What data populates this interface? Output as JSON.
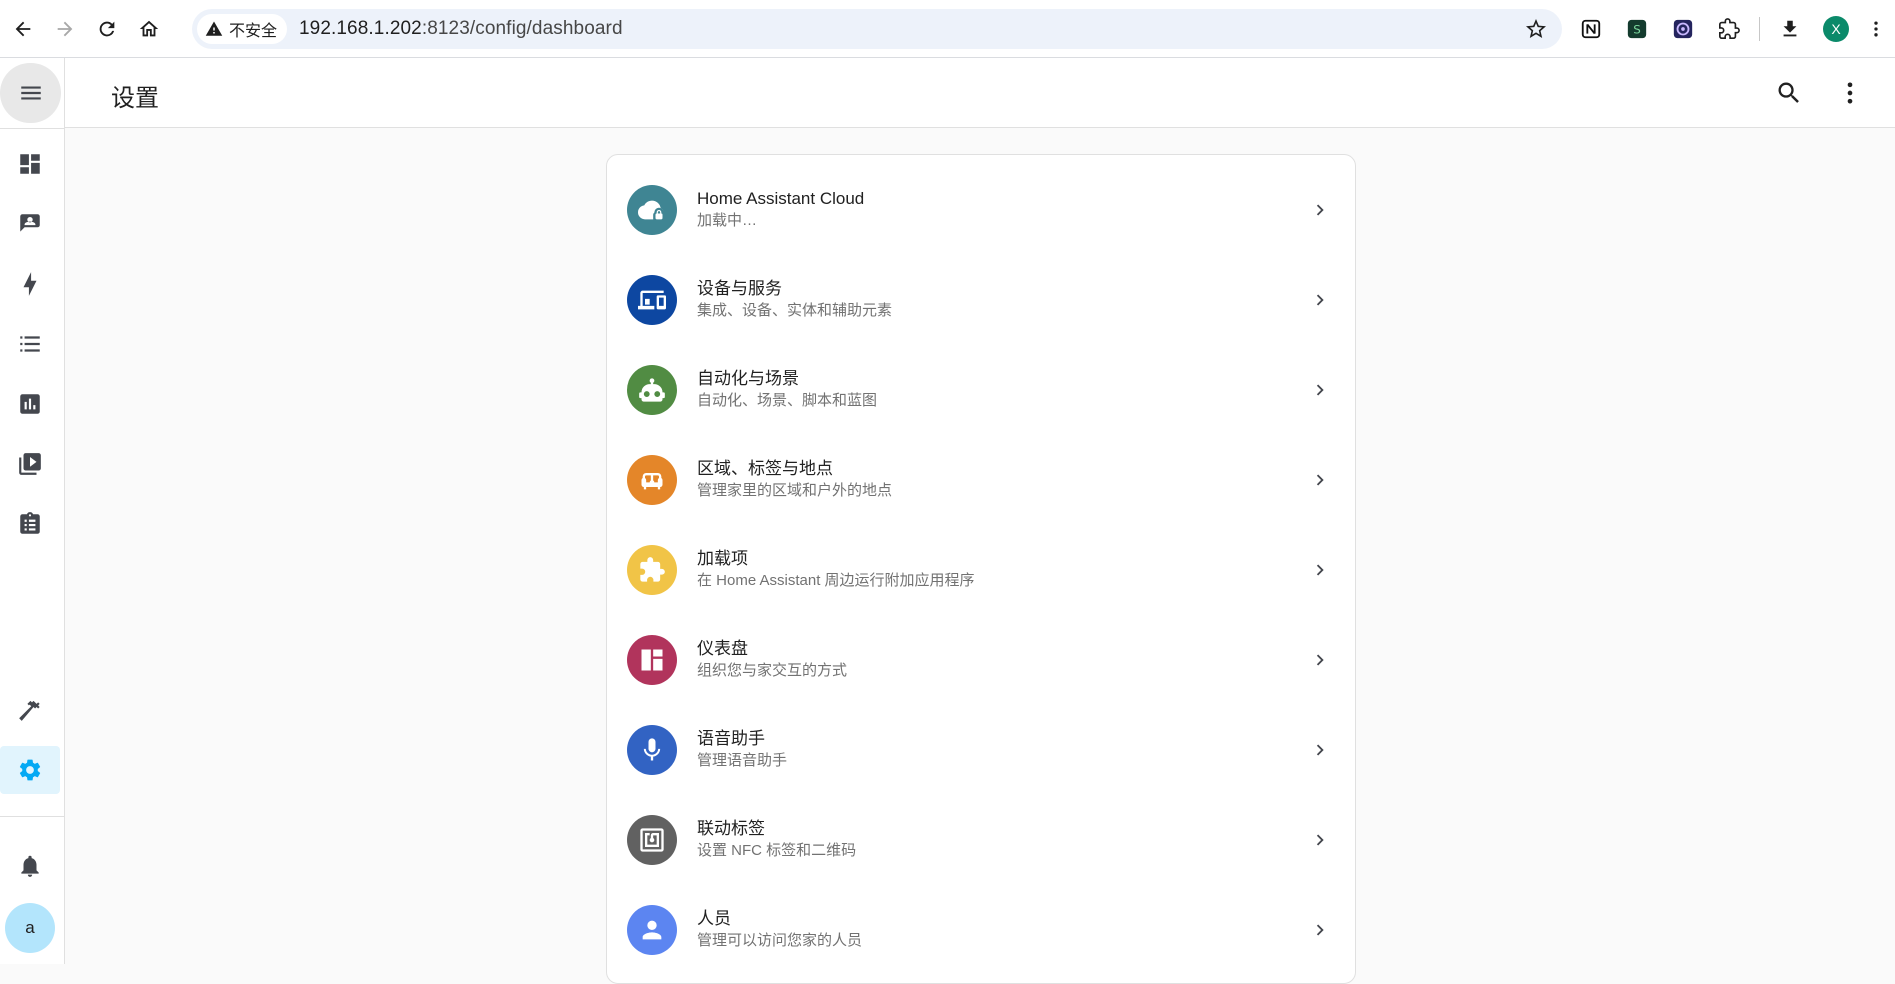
{
  "browser": {
    "insecure_label": "不安全",
    "url_host": "192.168.1.202",
    "url_path": ":8123/config/dashboard",
    "profile_initial": "X",
    "extensions": [
      "notion-icon",
      "docs-extension-icon",
      "vpn-extension-icon",
      "puzzle-icon"
    ]
  },
  "sidebar": {
    "items": [
      {
        "name": "overview",
        "icon": "dashboard-icon"
      },
      {
        "name": "map",
        "icon": "person-card-icon"
      },
      {
        "name": "energy",
        "icon": "lightning-icon"
      },
      {
        "name": "logbook",
        "icon": "list-icon"
      },
      {
        "name": "history",
        "icon": "chart-icon"
      },
      {
        "name": "media",
        "icon": "play-box-icon"
      },
      {
        "name": "todo",
        "icon": "clipboard-icon"
      }
    ],
    "developer_tools_icon": "hammer-icon",
    "settings_icon": "gear-icon",
    "notifications_icon": "bell-icon",
    "user_initial": "a"
  },
  "topbar": {
    "title": "设置"
  },
  "settings": {
    "rows": [
      {
        "title": "Home Assistant Cloud",
        "subtitle": "加载中…",
        "color": "#3f8593",
        "icon": "cloud-lock-icon"
      },
      {
        "title": "设备与服务",
        "subtitle": "集成、设备、实体和辅助元素",
        "color": "#0d47a1",
        "icon": "devices-icon"
      },
      {
        "title": "自动化与场景",
        "subtitle": "自动化、场景、脚本和蓝图",
        "color": "#518c43",
        "icon": "robot-icon"
      },
      {
        "title": "区域、标签与地点",
        "subtitle": "管理家里的区域和户外的地点",
        "color": "#e48629",
        "icon": "sofa-icon"
      },
      {
        "title": "加载项",
        "subtitle": "在 Home Assistant 周边运行附加应用程序",
        "color": "#f1c447",
        "icon": "puzzle-icon"
      },
      {
        "title": "仪表盘",
        "subtitle": "组织您与家交互的方式",
        "color": "#b1345c",
        "icon": "view-dashboard-icon"
      },
      {
        "title": "语音助手",
        "subtitle": "管理语音助手",
        "color": "#3263c3",
        "icon": "microphone-icon"
      },
      {
        "title": "联动标签",
        "subtitle": "设置 NFC 标签和二维码",
        "color": "#616161",
        "icon": "nfc-icon"
      },
      {
        "title": "人员",
        "subtitle": "管理可以访问您家的人员",
        "color": "#5c85f1",
        "icon": "person-icon"
      }
    ]
  }
}
